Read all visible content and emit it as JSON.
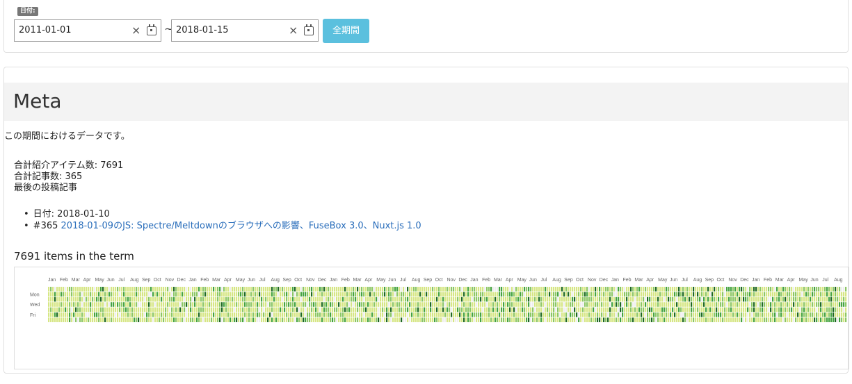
{
  "date_filter": {
    "badge": "日付:",
    "start_date": "2011-01-01",
    "tilde": "~",
    "end_date": "2018-01-15",
    "all_button": "全期間",
    "clear_glyph": "×",
    "icons": [
      "close-icon",
      "calendar-icon"
    ]
  },
  "meta": {
    "title": "Meta",
    "description": "この期間におけるデータです。",
    "total_items": "合計紹介アイテム数: 7691",
    "total_articles": "合計記事数: 365",
    "last_article_heading": "最後の投稿記事",
    "last_date": "日付: 2018-01-10",
    "last_article_prefix": "#365",
    "last_article_link": "2018-01-09のJS: Spectre/Meltdownのブラウザへの影響、FuseBox 3.0、Nuxt.js 1.0",
    "items_in_term": "7691 items in the term"
  },
  "chart_data": {
    "type": "heatmap",
    "title": "",
    "month_labels": [
      "Jan",
      "Feb",
      "Mar",
      "Apr",
      "May",
      "Jun",
      "Jul",
      "Aug",
      "Sep",
      "Oct",
      "Nov",
      "Dec",
      "Jan",
      "Feb",
      "Mar",
      "Apr",
      "May",
      "Jun",
      "Jul",
      "Aug",
      "Sep",
      "Oct",
      "Nov",
      "Dec",
      "Jan",
      "Feb",
      "Mar",
      "Apr",
      "May",
      "Jun",
      "Jul",
      "Aug",
      "Sep",
      "Oct",
      "Nov",
      "Dec",
      "Jan",
      "Feb",
      "Mar",
      "Apr",
      "May",
      "Jun",
      "Jul",
      "Aug",
      "Sep",
      "Oct",
      "Nov",
      "Dec",
      "Jan",
      "Feb",
      "Mar",
      "Apr",
      "May",
      "Jun",
      "Jul",
      "Aug",
      "Sep",
      "Oct",
      "Nov",
      "Dec",
      "Jan",
      "Feb",
      "Mar",
      "Apr",
      "May",
      "Jun",
      "Jul",
      "Aug"
    ],
    "day_labels": [
      "Mon",
      "Wed",
      "Fri"
    ],
    "colors": [
      "#eeeeee",
      "#d6e685",
      "#8cc665",
      "#44a340",
      "#1e6823"
    ],
    "cell_levels_note_omitted": true
  }
}
